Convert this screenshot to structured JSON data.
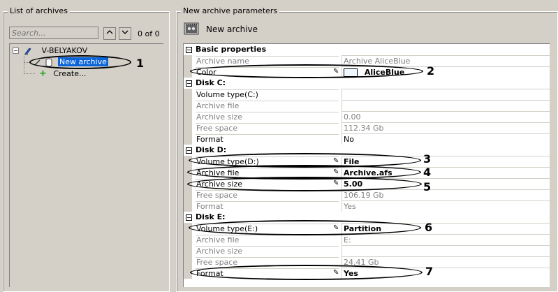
{
  "left_panel": {
    "title": "List of archives",
    "search_placeholder": "Search...",
    "counter": "0 of 0",
    "tree": {
      "computer": "V-BELYAKOV",
      "archive": "New archive",
      "create": "Create..."
    }
  },
  "right_panel": {
    "title": "New archive parameters",
    "archive_title": "New archive",
    "sections": [
      {
        "name": "Basic properties",
        "props": [
          {
            "name": "Archive name",
            "value": "Archive AliceBlue"
          },
          {
            "name": "Color",
            "value": "AliceBlue"
          }
        ]
      },
      {
        "name": "Disk C:",
        "props": [
          {
            "name": "Volume type(C:)",
            "value": ""
          },
          {
            "name": "Archive file",
            "value": ""
          },
          {
            "name": "Archive size",
            "value": "0.00"
          },
          {
            "name": "Free space",
            "value": "112.34 Gb"
          },
          {
            "name": "Format",
            "value": "No"
          }
        ]
      },
      {
        "name": "Disk D:",
        "props": [
          {
            "name": "Volume type(D:)",
            "value": "File"
          },
          {
            "name": "Archive file",
            "value": "Archive.afs"
          },
          {
            "name": "Archive size",
            "value": "5.00"
          },
          {
            "name": "Free space",
            "value": "106.19 Gb"
          },
          {
            "name": "Format",
            "value": "Yes"
          }
        ]
      },
      {
        "name": "Disk E:",
        "props": [
          {
            "name": "Volume type(E:)",
            "value": "Partition"
          },
          {
            "name": "Archive file",
            "value": "E:"
          },
          {
            "name": "Archive size",
            "value": ""
          },
          {
            "name": "Free space",
            "value": "24.41 Gb"
          },
          {
            "name": "Format",
            "value": "Yes"
          }
        ]
      }
    ]
  },
  "callouts": [
    "1",
    "2",
    "3",
    "4",
    "5",
    "6",
    "7"
  ],
  "colors": {
    "swatch": "#F0F8FF",
    "selection": "#0a64d8"
  }
}
